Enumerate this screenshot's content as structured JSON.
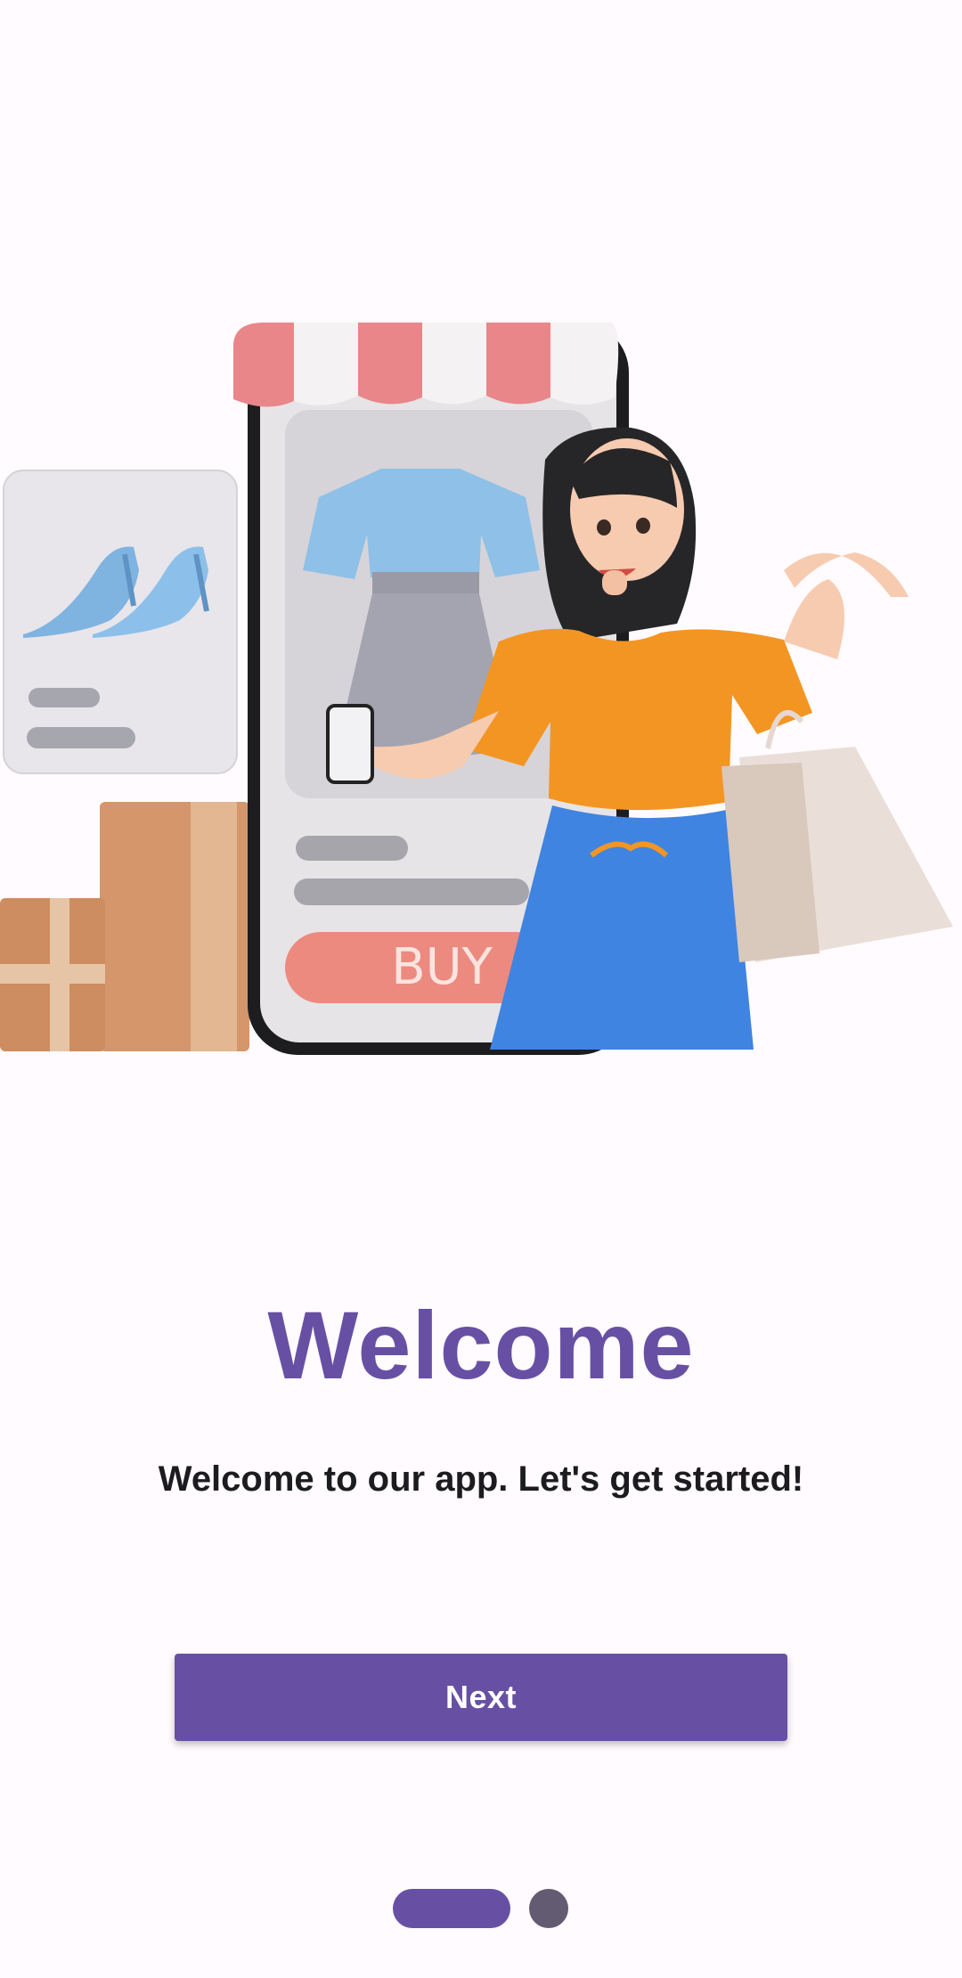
{
  "onboarding": {
    "illustration": {
      "icon": "shopping-illustration",
      "buy_label": "BUY"
    },
    "title": "Welcome",
    "subtitle": "Welcome to our app. Let's get started!",
    "next_button_label": "Next",
    "pager": {
      "page_count": 2,
      "current_page": 1
    }
  },
  "colors": {
    "primary": "#6750a4",
    "dot_inactive": "#625b71",
    "background": "#fffbfe"
  }
}
